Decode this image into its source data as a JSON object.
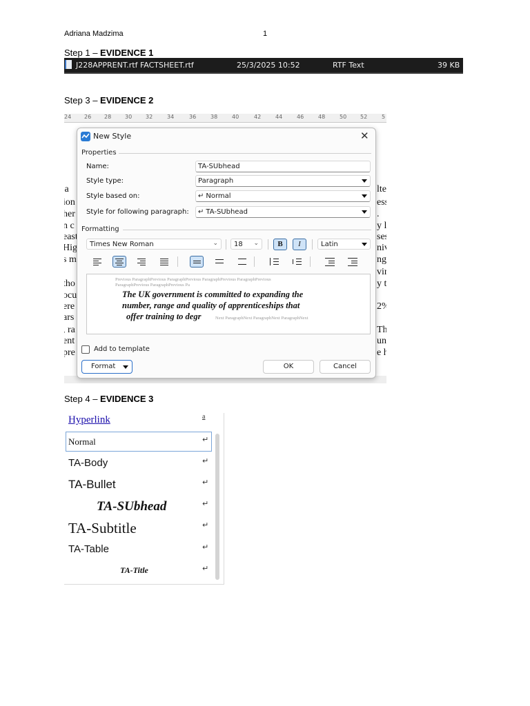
{
  "header": {
    "author": "Adriana Madzima",
    "page_number": "1"
  },
  "steps": [
    {
      "prefix": "Step 1 – ",
      "title": "EVIDENCE 1"
    },
    {
      "prefix": "Step 3 – ",
      "title": "EVIDENCE 2"
    },
    {
      "prefix": "Step 4 – ",
      "title": "EVIDENCE 3"
    }
  ],
  "file_row": {
    "name": "J228APPRENT.rtf FACTSHEET.rtf",
    "date_modified": "25/3/2025 10:52",
    "type": "RTF Text",
    "size": "39 KB",
    "icon": "rtf-file-icon"
  },
  "ruler_ticks": [
    "24",
    "26",
    "28",
    "30",
    "32",
    "34",
    "36",
    "38",
    "40",
    "42",
    "44",
    "46",
    "48",
    "50",
    "52",
    "5"
  ],
  "background_text": {
    "left_fragments": [
      "'a",
      "ion",
      "her",
      "n c",
      "east",
      "Hig",
      "s m",
      "",
      "tho",
      "ocu",
      "ere",
      "ars",
      ", ra",
      "ent",
      "pre"
    ],
    "right_fragments": [
      "lte",
      "ess",
      ".",
      "y li",
      "ses",
      "niv",
      "ng,",
      "vin",
      "y th",
      "",
      "2%",
      "",
      "The",
      "unc",
      "e h"
    ]
  },
  "dialog": {
    "title": "New Style",
    "properties_label": "Properties",
    "name_label": "Name:",
    "name_value": "TA-SUbhead",
    "style_type_label": "Style type:",
    "style_type_value": "Paragraph",
    "based_on_label": "Style based on:",
    "based_on_value": "Normal",
    "following_label": "Style for following paragraph:",
    "following_value": "TA-SUbhead",
    "formatting_label": "Formatting",
    "font_value": "Times New Roman",
    "size_value": "18",
    "bold_label": "B",
    "italic_label": "I",
    "script_value": "Latin",
    "preview_prev_1": "Previous ParagraphPrevious ParagraphPrevious ParagraphPrevious ParagraphPrevious",
    "preview_prev_2": "ParagraphPrevious ParagraphPrevious Pa",
    "preview_line_1": "The UK government is committed to expanding the",
    "preview_line_2": "number, range and quality of apprenticeships that",
    "preview_line_3": "offer training to degr",
    "preview_next": "Next ParagraphNext ParagraphNext ParagraphNext",
    "add_to_template_label": "Add to template",
    "add_to_template_checked": false,
    "format_button": "Format",
    "ok_button": "OK",
    "cancel_button": "Cancel",
    "return_glyph": "↵",
    "close_glyph": "✕",
    "accent_color": "#2a7bd4"
  },
  "style_list": [
    {
      "name": "Hyperlink",
      "mark": "a"
    },
    {
      "name": "Normal",
      "mark": "↵"
    },
    {
      "name": "TA-Body",
      "mark": "↵"
    },
    {
      "name": "TA-Bullet",
      "mark": "↵"
    },
    {
      "name": "TA-SUbhead",
      "mark": "↵"
    },
    {
      "name": "TA-Subtitle",
      "mark": "↵"
    },
    {
      "name": "TA-Table",
      "mark": "↵"
    },
    {
      "name": "TA-Title",
      "mark": "↵"
    }
  ]
}
